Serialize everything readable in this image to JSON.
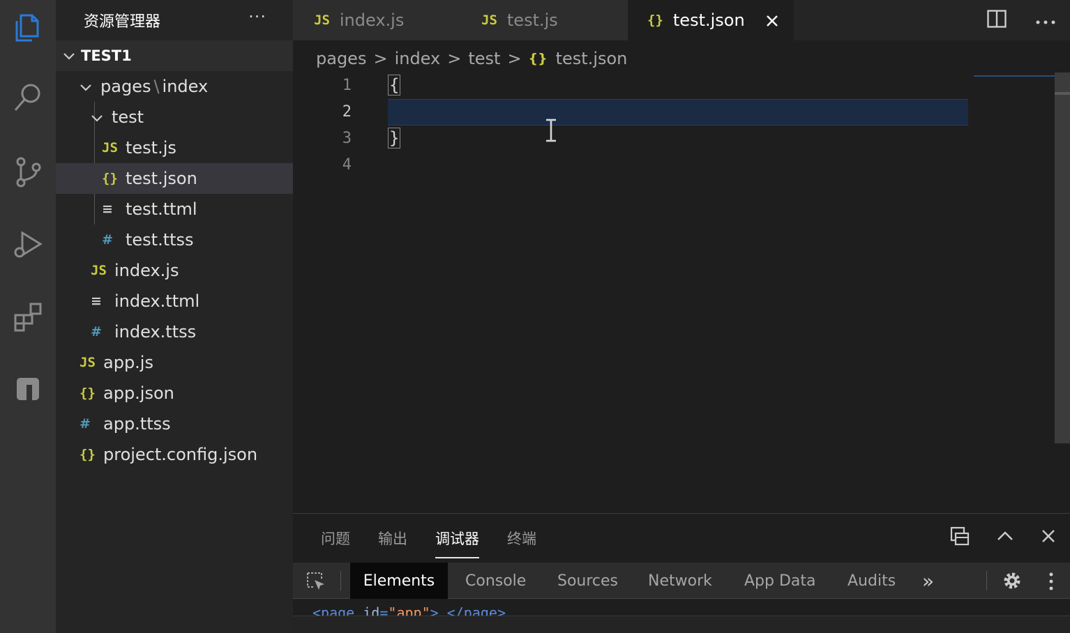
{
  "sidebar": {
    "title": "资源管理器",
    "more": "···",
    "section_title": "TEST1",
    "items": [
      {
        "label": "pages",
        "sub": "index",
        "icon": "chevron-down",
        "depth": 1
      },
      {
        "label": "test",
        "icon": "chevron-down",
        "depth": 2
      },
      {
        "label": "test.js",
        "icon": "js",
        "depth": 3
      },
      {
        "label": "test.json",
        "icon": "json",
        "depth": 3,
        "selected": true
      },
      {
        "label": "test.ttml",
        "icon": "lines",
        "depth": 3
      },
      {
        "label": "test.ttss",
        "icon": "hash",
        "depth": 3
      },
      {
        "label": "index.js",
        "icon": "js",
        "depth": 2
      },
      {
        "label": "index.ttml",
        "icon": "lines",
        "depth": 2
      },
      {
        "label": "index.ttss",
        "icon": "hash",
        "depth": 2
      },
      {
        "label": "app.js",
        "icon": "js",
        "depth": 1
      },
      {
        "label": "app.json",
        "icon": "json",
        "depth": 1
      },
      {
        "label": "app.ttss",
        "icon": "hash",
        "depth": 1
      },
      {
        "label": "project.config.json",
        "icon": "json",
        "depth": 1
      }
    ]
  },
  "icons": {
    "js": "JS",
    "json": "{}",
    "hash": "#",
    "lines": "≡",
    "pages_sep": "\\"
  },
  "tabs": [
    {
      "label": "index.js",
      "icon": "JS"
    },
    {
      "label": "test.js",
      "icon": "JS"
    },
    {
      "label": "test.json",
      "icon": "{}",
      "active": true
    }
  ],
  "breadcrumb": {
    "parts": [
      "pages",
      "index",
      "test"
    ],
    "file": "test.json",
    "file_icon": "{}",
    "sep": ">"
  },
  "editor": {
    "line_numbers": [
      "1",
      "2",
      "3",
      "4"
    ],
    "current_line": 2,
    "lines": [
      "{",
      "",
      "}",
      ""
    ]
  },
  "panel": {
    "tabs": [
      "问题",
      "输出",
      "调试器",
      "终端"
    ],
    "active_tab": "调试器"
  },
  "devtools": {
    "tabs": [
      "Elements",
      "Console",
      "Sources",
      "Network",
      "App Data",
      "Audits"
    ],
    "active_tab": "Elements",
    "overflow": "»",
    "dom_tag_open": "<page",
    "dom_attr": "id",
    "dom_eq": "=",
    "dom_val": "\"app\"",
    "dom_tail": "> </page>"
  },
  "colors": {
    "accent": "#2b79d7",
    "json_icon": "#cbcb41",
    "hash_icon": "#519aba",
    "cur_line": "#1b2b44"
  }
}
